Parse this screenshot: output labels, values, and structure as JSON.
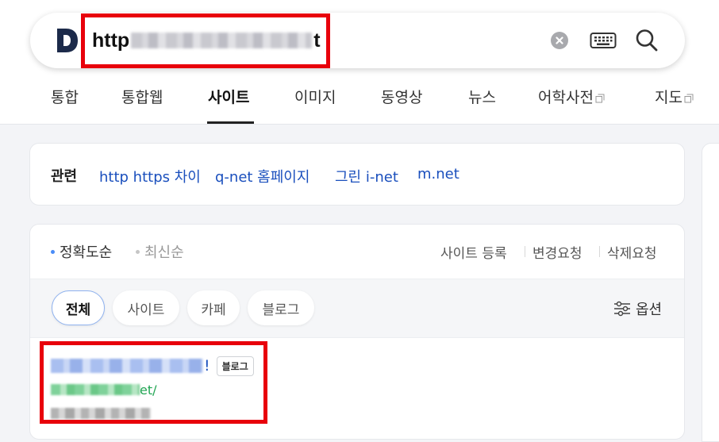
{
  "search": {
    "logo_letter": "D",
    "query_prefix": "http",
    "query_suffix": "t"
  },
  "tabs": [
    {
      "label": "통합",
      "active": false,
      "external": false
    },
    {
      "label": "통합웹",
      "active": false,
      "external": false
    },
    {
      "label": "사이트",
      "active": true,
      "external": false
    },
    {
      "label": "이미지",
      "active": false,
      "external": false
    },
    {
      "label": "동영상",
      "active": false,
      "external": false
    },
    {
      "label": "뉴스",
      "active": false,
      "external": false
    },
    {
      "label": "어학사전",
      "active": false,
      "external": true
    },
    {
      "label": "지도",
      "active": false,
      "external": true
    }
  ],
  "related": {
    "label": "관련",
    "links": [
      "http https 차이",
      "q-net 홈페이지",
      "그린 i-net",
      "m.net"
    ]
  },
  "sort": {
    "accuracy": "정확도순",
    "recent": "최신순"
  },
  "actions": [
    "사이트 등록",
    "변경요청",
    "삭제요청"
  ],
  "filters": {
    "chips": [
      "전체",
      "사이트",
      "카페",
      "블로그"
    ],
    "options_label": "옵션"
  },
  "result": {
    "title_end": "!",
    "badge": "블로그",
    "url_end": "et/"
  },
  "colors": {
    "highlight": "#e8000b",
    "link_blue": "#1a4fbd",
    "url_green": "#21a553",
    "logo_navy": "#1c2a4a"
  }
}
